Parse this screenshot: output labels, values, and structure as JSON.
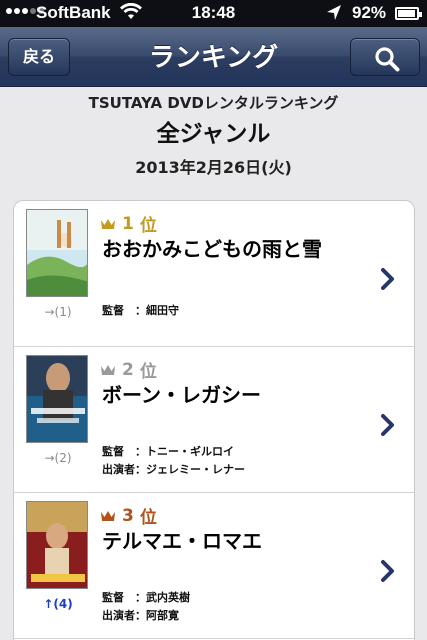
{
  "status_bar": {
    "carrier": "SoftBank",
    "time": "18:48",
    "battery_percent": "92%",
    "battery_level": 0.92
  },
  "navbar": {
    "back_label": "戻る",
    "title": "ランキング",
    "search_icon": "search-icon"
  },
  "header": {
    "line1": "TSUTAYA DVDレンタルランキング",
    "genre": "全ジャンル",
    "date": "2013年2月26日(火)"
  },
  "rankings": [
    {
      "rank": "1",
      "rank_suffix": "位",
      "crown_color": "#c59a1e",
      "title": "おおかみこどもの雨と雪",
      "trend": "→(1)",
      "director_label": "監督　：",
      "director": "細田守",
      "cast_label": "",
      "cast": ""
    },
    {
      "rank": "2",
      "rank_suffix": "位",
      "crown_color": "#9a9a9a",
      "title": "ボーン・レガシー",
      "trend": "→(2)",
      "director_label": "監督　：",
      "director": "トニー・ギルロイ",
      "cast_label": "出演者：",
      "cast": "ジェレミー・レナー"
    },
    {
      "rank": "3",
      "rank_suffix": "位",
      "crown_color": "#b0531c",
      "title": "テルマエ・ロマエ",
      "trend": "↑(4)",
      "director_label": "監督　：",
      "director": "武内英樹",
      "cast_label": "出演者：",
      "cast": "阿部寛"
    }
  ]
}
